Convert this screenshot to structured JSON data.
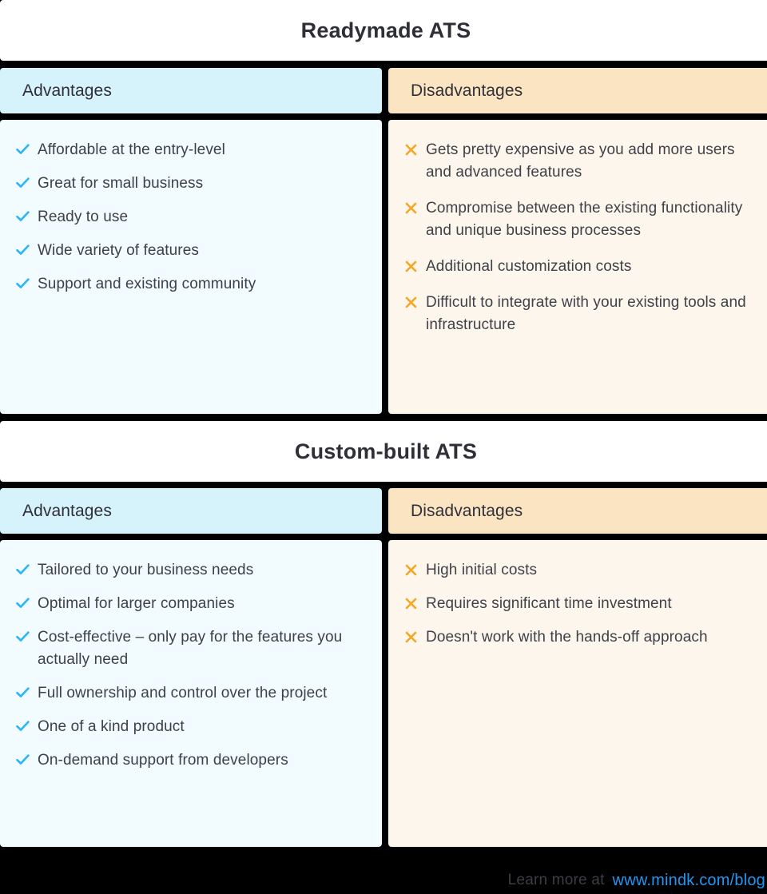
{
  "colors": {
    "background": "#000000",
    "advantage_header_bg": "#d6f2fa",
    "disadvantage_header_bg": "#fbe4c1",
    "advantage_panel_bg": "#f2fbfd",
    "disadvantage_panel_bg": "#fdf6ec",
    "check_icon": "#29b6f6",
    "cross_icon": "#f5a623",
    "text": "#3f4149",
    "title_text": "#2f2f38",
    "link": "#2196f3"
  },
  "sections": [
    {
      "title": "Readymade ATS",
      "advantages": {
        "header": "Advantages",
        "items": [
          "Affordable at the entry-level",
          "Great for small business",
          "Ready to use",
          "Wide variety of features",
          "Support and existing community"
        ]
      },
      "disadvantages": {
        "header": "Disadvantages",
        "items": [
          "Gets pretty expensive as you add more users and advanced features",
          "Compromise between the existing functionality and unique business processes",
          "Additional customization costs",
          "Difficult to integrate with your existing tools and infrastructure"
        ]
      }
    },
    {
      "title": "Custom-built ATS",
      "advantages": {
        "header": "Advantages",
        "items": [
          "Tailored to your business needs",
          "Optimal for larger companies",
          "Cost-effective – only pay for the features you actually need",
          "Full ownership and control over the project",
          "One of a kind product",
          "On-demand support from developers"
        ]
      },
      "disadvantages": {
        "header": "Disadvantages",
        "items": [
          "High initial costs",
          "Requires significant time investment",
          "Doesn't work with the hands-off approach"
        ]
      }
    }
  ],
  "footer": {
    "learn_more_label": "Learn more at",
    "url": "www.mindk.com/blog"
  }
}
